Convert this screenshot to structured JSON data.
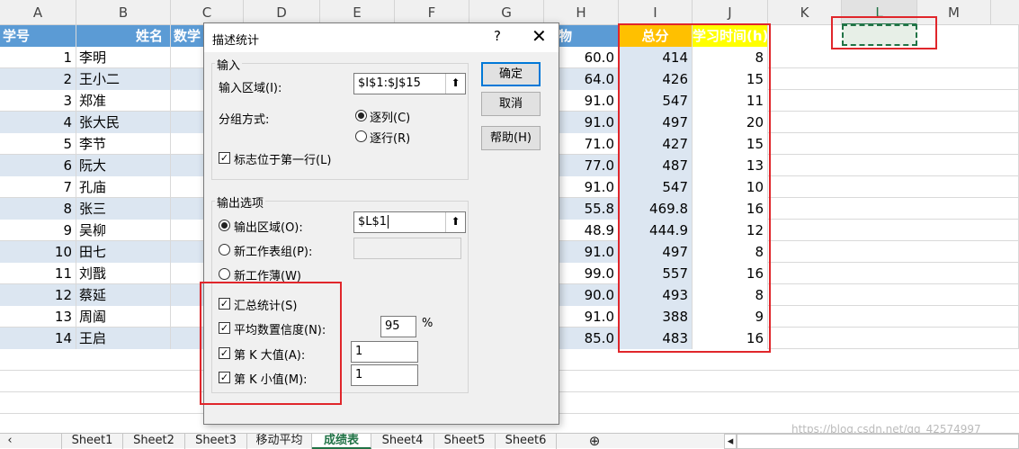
{
  "columns": [
    "A",
    "B",
    "C",
    "D",
    "E",
    "F",
    "G",
    "H",
    "I",
    "J",
    "K",
    "L",
    "M"
  ],
  "headers": {
    "a": "学号",
    "b": "姓名",
    "c": "数学",
    "h": "物",
    "i": "总分",
    "j": "学习时间(h)"
  },
  "rows": [
    {
      "id": "1",
      "name": "李明",
      "h": "60.0",
      "i": "414",
      "j": "8"
    },
    {
      "id": "2",
      "name": "王小二",
      "h": "64.0",
      "i": "426",
      "j": "15"
    },
    {
      "id": "3",
      "name": "郑准",
      "h": "91.0",
      "i": "547",
      "j": "11"
    },
    {
      "id": "4",
      "name": "张大民",
      "h": "91.0",
      "i": "497",
      "j": "20"
    },
    {
      "id": "5",
      "name": "李节",
      "h": "71.0",
      "i": "427",
      "j": "15"
    },
    {
      "id": "6",
      "name": "阮大",
      "h": "77.0",
      "i": "487",
      "j": "13"
    },
    {
      "id": "7",
      "name": "孔庙",
      "h": "91.0",
      "i": "547",
      "j": "10"
    },
    {
      "id": "8",
      "name": "张三",
      "h": "55.8",
      "i": "469.8",
      "j": "16"
    },
    {
      "id": "9",
      "name": "吴柳",
      "h": "48.9",
      "i": "444.9",
      "j": "12"
    },
    {
      "id": "10",
      "name": "田七",
      "h": "91.0",
      "i": "497",
      "j": "8"
    },
    {
      "id": "11",
      "name": "刘戬",
      "h": "99.0",
      "i": "557",
      "j": "16"
    },
    {
      "id": "12",
      "name": "蔡延",
      "h": "90.0",
      "i": "493",
      "j": "8"
    },
    {
      "id": "13",
      "name": "周阖",
      "h": "91.0",
      "i": "388",
      "j": "9"
    },
    {
      "id": "14",
      "name": "王启",
      "h": "85.0",
      "i": "483",
      "j": "16"
    }
  ],
  "sheets": [
    "Sheet1",
    "Sheet2",
    "Sheet3",
    "移动平均",
    "成绩表",
    "Sheet4",
    "Sheet5",
    "Sheet6"
  ],
  "active_sheet_index": 4,
  "add_sheet": "⊕",
  "watermark": "https://blog.csdn.net/qq_42574997",
  "dialog": {
    "title": "描述统计",
    "help_glyph": "?",
    "close_glyph": "✕",
    "input_group": "输入",
    "input_range_label": "输入区域(I):",
    "input_range_value": "$I$1:$J$15",
    "group_by_label": "分组方式:",
    "by_column": "逐列(C)",
    "by_row": "逐行(R)",
    "labels_first_row": "标志位于第一行(L)",
    "output_group": "输出选项",
    "output_range_label": "输出区域(O):",
    "output_range_value": "$L$1",
    "new_sheet_label": "新工作表组(P):",
    "new_workbook_label": "新工作薄(W)",
    "summary_stats": "汇总统计(S)",
    "confidence_label": "平均数置信度(N):",
    "confidence_value": "95",
    "percent": "%",
    "kth_largest_label": "第 K 大值(A):",
    "kth_largest_value": "1",
    "kth_smallest_label": "第 K 小值(M):",
    "kth_smallest_value": "1",
    "ok": "确定",
    "cancel": "取消",
    "help": "帮助(H)"
  },
  "colors": {
    "header_blue": "#5b9bd5",
    "band_blue": "#dce6f1",
    "total_header": "#ffc000",
    "time_header": "#ffff00",
    "highlight_red": "#e0262b",
    "excel_green": "#217346"
  }
}
